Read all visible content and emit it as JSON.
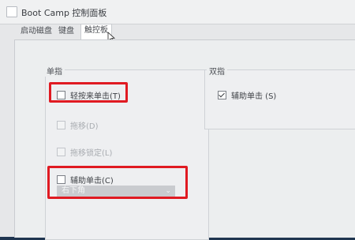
{
  "window": {
    "title": "Boot Camp 控制面板"
  },
  "tabs": [
    {
      "label": "启动磁盘",
      "active": false
    },
    {
      "label": "键盘",
      "active": false
    },
    {
      "label": "触控板",
      "active": true
    }
  ],
  "single_finger": {
    "title": "单指",
    "options": [
      {
        "label": "轻按来单击(T)",
        "checked": false,
        "enabled": true
      },
      {
        "label": "拖移(D)",
        "checked": false,
        "enabled": false
      },
      {
        "label": "拖移锁定(L)",
        "checked": false,
        "enabled": false
      },
      {
        "label": "辅助单击(C)",
        "checked": false,
        "enabled": true
      }
    ],
    "secondary_click_dropdown": {
      "value": "右下角",
      "enabled": false
    }
  },
  "two_finger": {
    "title": "双指",
    "options": [
      {
        "label": "辅助单击 (S)",
        "checked": true,
        "enabled": true
      }
    ]
  },
  "colors": {
    "highlight": "#e01a22",
    "panel": "#eceeef",
    "disabled_text": "#a9acb1"
  },
  "icons": {
    "app": "bootcamp-app-icon",
    "cursor": "mouse-pointer-icon",
    "dropdown": "chevron-down-icon"
  }
}
